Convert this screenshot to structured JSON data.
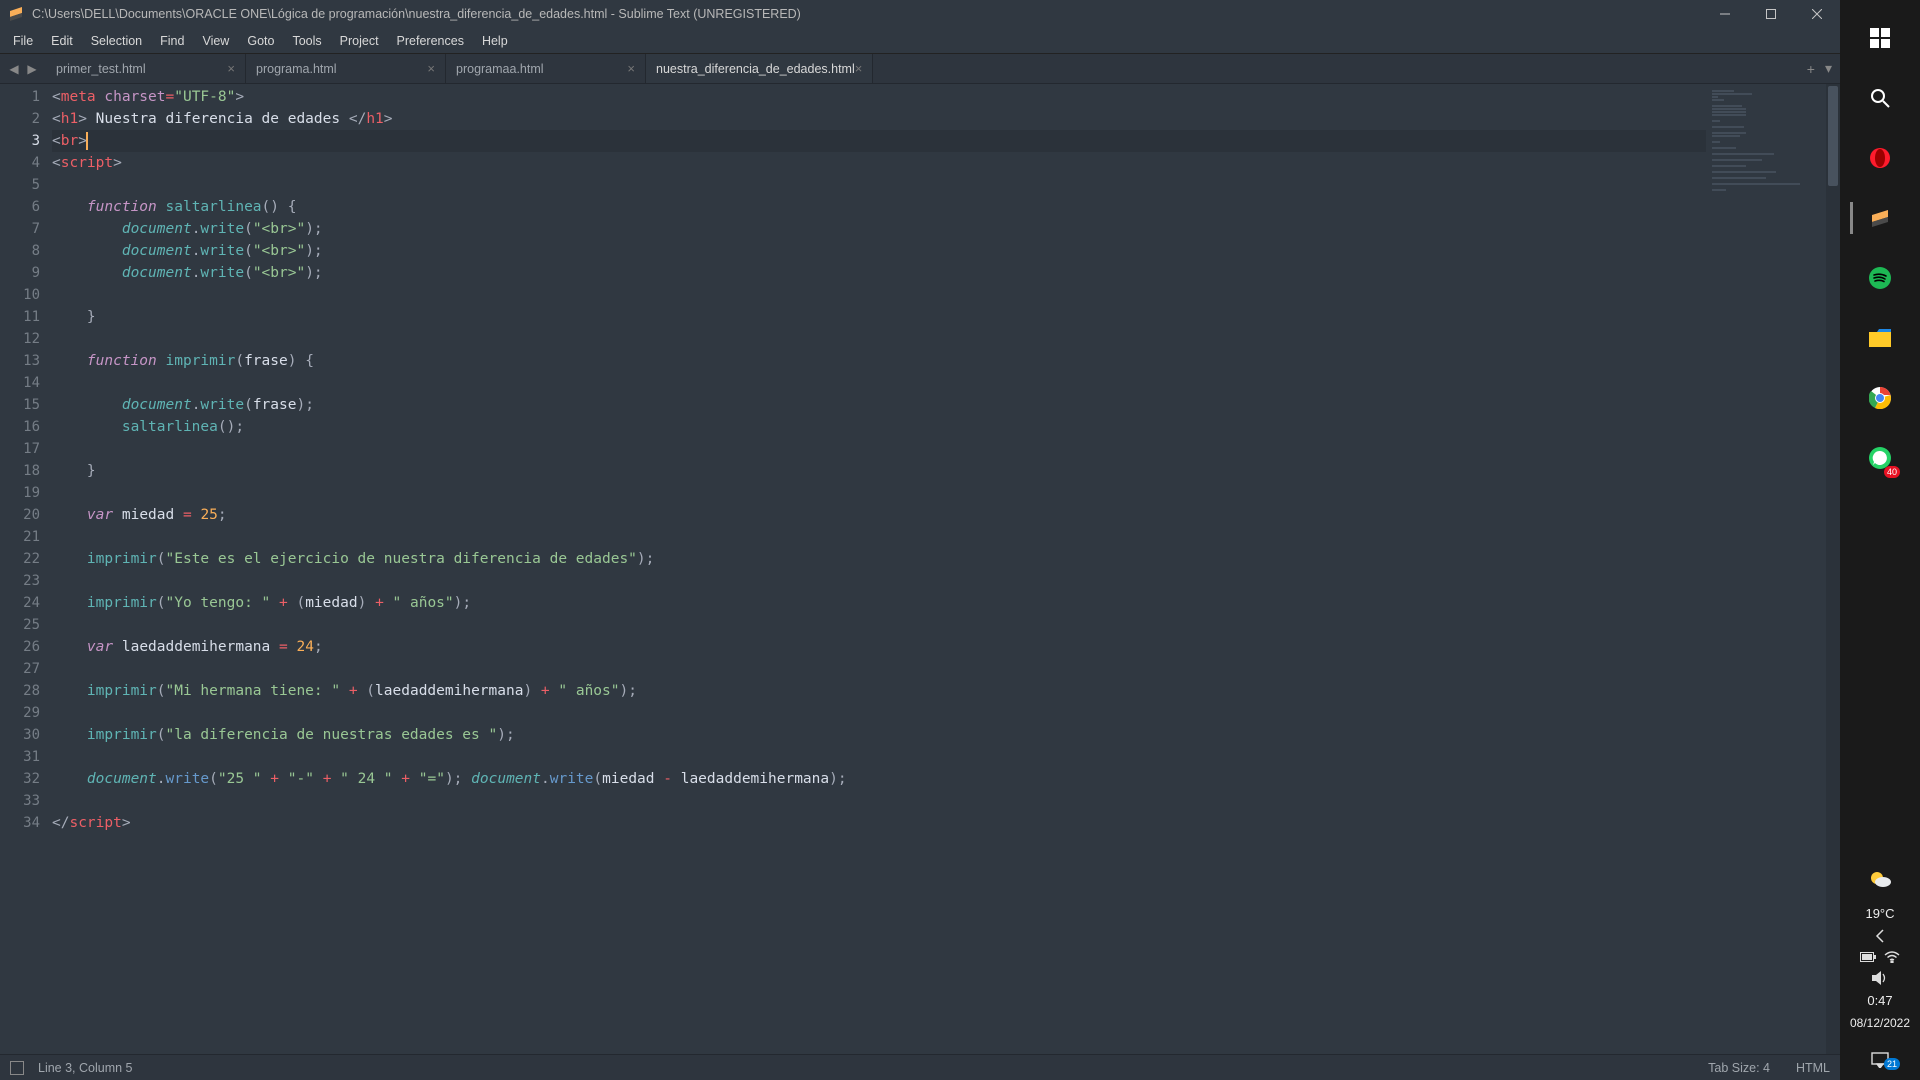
{
  "titlebar": {
    "path": "C:\\Users\\DELL\\Documents\\ORACLE ONE\\Lógica de programación\\nuestra_diferencia_de_edades.html - Sublime Text (UNREGISTERED)"
  },
  "menu": {
    "items": [
      "File",
      "Edit",
      "Selection",
      "Find",
      "View",
      "Goto",
      "Tools",
      "Project",
      "Preferences",
      "Help"
    ]
  },
  "tabs": {
    "list": [
      {
        "label": "primer_test.html",
        "active": false
      },
      {
        "label": "programa.html",
        "active": false
      },
      {
        "label": "programaa.html",
        "active": false
      },
      {
        "label": "nuestra_diferencia_de_edades.html",
        "active": true
      }
    ],
    "add_label": "+",
    "menu_label": "▾"
  },
  "editor": {
    "active_line": 3,
    "modified_lines": [
      20,
      22,
      24,
      26,
      28,
      30,
      32
    ],
    "lines": [
      {
        "n": 1,
        "tokens": [
          {
            "t": "<",
            "c": "c-punc"
          },
          {
            "t": "meta",
            "c": "c-tag"
          },
          {
            "t": " ",
            "c": ""
          },
          {
            "t": "charset",
            "c": "c-attr"
          },
          {
            "t": "=",
            "c": "c-op"
          },
          {
            "t": "\"UTF-8\"",
            "c": "c-str"
          },
          {
            "t": ">",
            "c": "c-punc"
          }
        ]
      },
      {
        "n": 2,
        "tokens": [
          {
            "t": "<",
            "c": "c-punc"
          },
          {
            "t": "h1",
            "c": "c-tag"
          },
          {
            "t": ">",
            "c": "c-punc"
          },
          {
            "t": " Nuestra diferencia de edades ",
            "c": "c-ident"
          },
          {
            "t": "</",
            "c": "c-punc"
          },
          {
            "t": "h1",
            "c": "c-tag"
          },
          {
            "t": ">",
            "c": "c-punc"
          }
        ]
      },
      {
        "n": 3,
        "tokens": [
          {
            "t": "<",
            "c": "c-punc"
          },
          {
            "t": "br",
            "c": "c-tag"
          },
          {
            "t": ">",
            "c": "c-punc"
          }
        ],
        "caret": true
      },
      {
        "n": 4,
        "tokens": [
          {
            "t": "<",
            "c": "c-punc"
          },
          {
            "t": "script",
            "c": "c-tag"
          },
          {
            "t": ">",
            "c": "c-punc"
          }
        ]
      },
      {
        "n": 5,
        "tokens": []
      },
      {
        "n": 6,
        "tokens": [
          {
            "t": "    ",
            "c": ""
          },
          {
            "t": "function",
            "c": "c-kw"
          },
          {
            "t": " ",
            "c": ""
          },
          {
            "t": "saltarlinea",
            "c": "c-call"
          },
          {
            "t": "() {",
            "c": "c-punc"
          }
        ]
      },
      {
        "n": 7,
        "tokens": [
          {
            "t": "        ",
            "c": ""
          },
          {
            "t": "document",
            "c": "c-obj"
          },
          {
            "t": ".",
            "c": "c-punc"
          },
          {
            "t": "write",
            "c": "c-call"
          },
          {
            "t": "(",
            "c": "c-punc"
          },
          {
            "t": "\"<br>\"",
            "c": "c-str"
          },
          {
            "t": ");",
            "c": "c-punc"
          }
        ]
      },
      {
        "n": 8,
        "tokens": [
          {
            "t": "        ",
            "c": ""
          },
          {
            "t": "document",
            "c": "c-obj"
          },
          {
            "t": ".",
            "c": "c-punc"
          },
          {
            "t": "write",
            "c": "c-call"
          },
          {
            "t": "(",
            "c": "c-punc"
          },
          {
            "t": "\"<br>\"",
            "c": "c-str"
          },
          {
            "t": ");",
            "c": "c-punc"
          }
        ]
      },
      {
        "n": 9,
        "tokens": [
          {
            "t": "        ",
            "c": ""
          },
          {
            "t": "document",
            "c": "c-obj"
          },
          {
            "t": ".",
            "c": "c-punc"
          },
          {
            "t": "write",
            "c": "c-call"
          },
          {
            "t": "(",
            "c": "c-punc"
          },
          {
            "t": "\"<br>\"",
            "c": "c-str"
          },
          {
            "t": ");",
            "c": "c-punc"
          }
        ]
      },
      {
        "n": 10,
        "tokens": []
      },
      {
        "n": 11,
        "tokens": [
          {
            "t": "    }",
            "c": "c-punc"
          }
        ]
      },
      {
        "n": 12,
        "tokens": []
      },
      {
        "n": 13,
        "tokens": [
          {
            "t": "    ",
            "c": ""
          },
          {
            "t": "function",
            "c": "c-kw"
          },
          {
            "t": " ",
            "c": ""
          },
          {
            "t": "imprimir",
            "c": "c-call"
          },
          {
            "t": "(",
            "c": "c-punc"
          },
          {
            "t": "frase",
            "c": "c-ident"
          },
          {
            "t": ") {",
            "c": "c-punc"
          }
        ]
      },
      {
        "n": 14,
        "tokens": []
      },
      {
        "n": 15,
        "tokens": [
          {
            "t": "        ",
            "c": ""
          },
          {
            "t": "document",
            "c": "c-obj"
          },
          {
            "t": ".",
            "c": "c-punc"
          },
          {
            "t": "write",
            "c": "c-call"
          },
          {
            "t": "(",
            "c": "c-punc"
          },
          {
            "t": "frase",
            "c": "c-ident"
          },
          {
            "t": ");",
            "c": "c-punc"
          }
        ]
      },
      {
        "n": 16,
        "tokens": [
          {
            "t": "        ",
            "c": ""
          },
          {
            "t": "saltarlinea",
            "c": "c-call"
          },
          {
            "t": "();",
            "c": "c-punc"
          }
        ]
      },
      {
        "n": 17,
        "tokens": []
      },
      {
        "n": 18,
        "tokens": [
          {
            "t": "    }",
            "c": "c-punc"
          }
        ]
      },
      {
        "n": 19,
        "tokens": []
      },
      {
        "n": 20,
        "tokens": [
          {
            "t": "    ",
            "c": ""
          },
          {
            "t": "var",
            "c": "c-kwvar"
          },
          {
            "t": " ",
            "c": ""
          },
          {
            "t": "miedad",
            "c": "c-ident"
          },
          {
            "t": " ",
            "c": ""
          },
          {
            "t": "=",
            "c": "c-op"
          },
          {
            "t": " ",
            "c": ""
          },
          {
            "t": "25",
            "c": "c-num"
          },
          {
            "t": ";",
            "c": "c-punc"
          }
        ]
      },
      {
        "n": 21,
        "tokens": []
      },
      {
        "n": 22,
        "tokens": [
          {
            "t": "    ",
            "c": ""
          },
          {
            "t": "imprimir",
            "c": "c-call"
          },
          {
            "t": "(",
            "c": "c-punc"
          },
          {
            "t": "\"Este es el ejercicio de nuestra diferencia de edades\"",
            "c": "c-str"
          },
          {
            "t": ");",
            "c": "c-punc"
          }
        ]
      },
      {
        "n": 23,
        "tokens": []
      },
      {
        "n": 24,
        "tokens": [
          {
            "t": "    ",
            "c": ""
          },
          {
            "t": "imprimir",
            "c": "c-call"
          },
          {
            "t": "(",
            "c": "c-punc"
          },
          {
            "t": "\"Yo tengo: \"",
            "c": "c-str"
          },
          {
            "t": " ",
            "c": ""
          },
          {
            "t": "+",
            "c": "c-op"
          },
          {
            "t": " (",
            "c": "c-punc"
          },
          {
            "t": "miedad",
            "c": "c-ident"
          },
          {
            "t": ") ",
            "c": "c-punc"
          },
          {
            "t": "+",
            "c": "c-op"
          },
          {
            "t": " ",
            "c": ""
          },
          {
            "t": "\" años\"",
            "c": "c-str"
          },
          {
            "t": ");",
            "c": "c-punc"
          }
        ]
      },
      {
        "n": 25,
        "tokens": []
      },
      {
        "n": 26,
        "tokens": [
          {
            "t": "    ",
            "c": ""
          },
          {
            "t": "var",
            "c": "c-kwvar"
          },
          {
            "t": " ",
            "c": ""
          },
          {
            "t": "laedaddemihermana",
            "c": "c-ident"
          },
          {
            "t": " ",
            "c": ""
          },
          {
            "t": "=",
            "c": "c-op"
          },
          {
            "t": " ",
            "c": ""
          },
          {
            "t": "24",
            "c": "c-num"
          },
          {
            "t": ";",
            "c": "c-punc"
          }
        ]
      },
      {
        "n": 27,
        "tokens": []
      },
      {
        "n": 28,
        "tokens": [
          {
            "t": "    ",
            "c": ""
          },
          {
            "t": "imprimir",
            "c": "c-call"
          },
          {
            "t": "(",
            "c": "c-punc"
          },
          {
            "t": "\"Mi hermana tiene: \"",
            "c": "c-str"
          },
          {
            "t": " ",
            "c": ""
          },
          {
            "t": "+",
            "c": "c-op"
          },
          {
            "t": " (",
            "c": "c-punc"
          },
          {
            "t": "laedaddemihermana",
            "c": "c-ident"
          },
          {
            "t": ") ",
            "c": "c-punc"
          },
          {
            "t": "+",
            "c": "c-op"
          },
          {
            "t": " ",
            "c": ""
          },
          {
            "t": "\" años\"",
            "c": "c-str"
          },
          {
            "t": ");",
            "c": "c-punc"
          }
        ]
      },
      {
        "n": 29,
        "tokens": []
      },
      {
        "n": 30,
        "tokens": [
          {
            "t": "    ",
            "c": ""
          },
          {
            "t": "imprimir",
            "c": "c-call"
          },
          {
            "t": "(",
            "c": "c-punc"
          },
          {
            "t": "\"la diferencia de nuestras edades es \"",
            "c": "c-str"
          },
          {
            "t": ");",
            "c": "c-punc"
          }
        ]
      },
      {
        "n": 31,
        "tokens": []
      },
      {
        "n": 32,
        "tokens": [
          {
            "t": "    ",
            "c": ""
          },
          {
            "t": "document",
            "c": "c-obj"
          },
          {
            "t": ".",
            "c": "c-punc"
          },
          {
            "t": "write",
            "c": "c-func"
          },
          {
            "t": "(",
            "c": "c-punc"
          },
          {
            "t": "\"25 \"",
            "c": "c-str"
          },
          {
            "t": " ",
            "c": ""
          },
          {
            "t": "+",
            "c": "c-op"
          },
          {
            "t": " ",
            "c": ""
          },
          {
            "t": "\"-\"",
            "c": "c-str"
          },
          {
            "t": " ",
            "c": ""
          },
          {
            "t": "+",
            "c": "c-op"
          },
          {
            "t": " ",
            "c": ""
          },
          {
            "t": "\" 24 \"",
            "c": "c-str"
          },
          {
            "t": " ",
            "c": ""
          },
          {
            "t": "+",
            "c": "c-op"
          },
          {
            "t": " ",
            "c": ""
          },
          {
            "t": "\"=\"",
            "c": "c-str"
          },
          {
            "t": "); ",
            "c": "c-punc"
          },
          {
            "t": "document",
            "c": "c-obj"
          },
          {
            "t": ".",
            "c": "c-punc"
          },
          {
            "t": "write",
            "c": "c-func"
          },
          {
            "t": "(",
            "c": "c-punc"
          },
          {
            "t": "miedad",
            "c": "c-ident"
          },
          {
            "t": " ",
            "c": ""
          },
          {
            "t": "-",
            "c": "c-op"
          },
          {
            "t": " ",
            "c": ""
          },
          {
            "t": "laedaddemihermana",
            "c": "c-ident"
          },
          {
            "t": ");",
            "c": "c-punc"
          }
        ]
      },
      {
        "n": 33,
        "tokens": []
      },
      {
        "n": 34,
        "tokens": [
          {
            "t": "</",
            "c": "c-punc"
          },
          {
            "t": "script",
            "c": "c-tag"
          },
          {
            "t": ">",
            "c": "c-punc"
          }
        ]
      }
    ],
    "minimap_widths": [
      22,
      40,
      6,
      12,
      0,
      30,
      34,
      34,
      34,
      0,
      8,
      0,
      32,
      0,
      34,
      28,
      0,
      8,
      0,
      24,
      0,
      62,
      0,
      50,
      0,
      34,
      0,
      64,
      0,
      54,
      0,
      88,
      0,
      14
    ]
  },
  "statusbar": {
    "position": "Line 3, Column 5",
    "tabsize": "Tab Size: 4",
    "syntax": "HTML"
  },
  "taskbar": {
    "weather_temp": "19°C",
    "time": "0:47",
    "date": "08/12/2022",
    "whatsapp_badge": "40",
    "notif_badge": "21"
  }
}
